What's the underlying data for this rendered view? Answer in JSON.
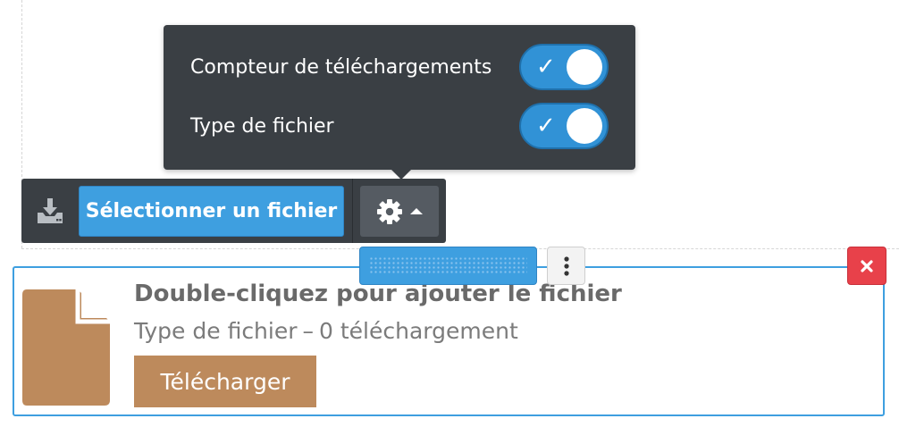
{
  "popover": {
    "options": [
      {
        "label": "Compteur de téléchargements",
        "enabled": true,
        "check_glyph": "✓"
      },
      {
        "label": "Type de fichier",
        "enabled": true,
        "check_glyph": "✓"
      }
    ]
  },
  "toolbar": {
    "download_icon": "download-tray-icon",
    "select_label": "Sélectionner un fichier",
    "settings_icon": "gear-icon",
    "caret_icon": "caret-up-icon"
  },
  "block_controls": {
    "drag_icon": "drag-handle-icon",
    "more_icon": "vertical-ellipsis-icon",
    "remove_icon": "close-icon"
  },
  "file": {
    "icon": "file-icon",
    "title": "Double-cliquez pour ajouter le fichier",
    "type_label": "Type de fichier",
    "separator": "–",
    "downloads": "0 téléchargement",
    "download_button": "Télécharger"
  },
  "colors": {
    "accent": "#3e9fe0",
    "dark_panel": "#3a3f44",
    "file_brown": "#bd8a5c",
    "danger": "#e8414a"
  }
}
